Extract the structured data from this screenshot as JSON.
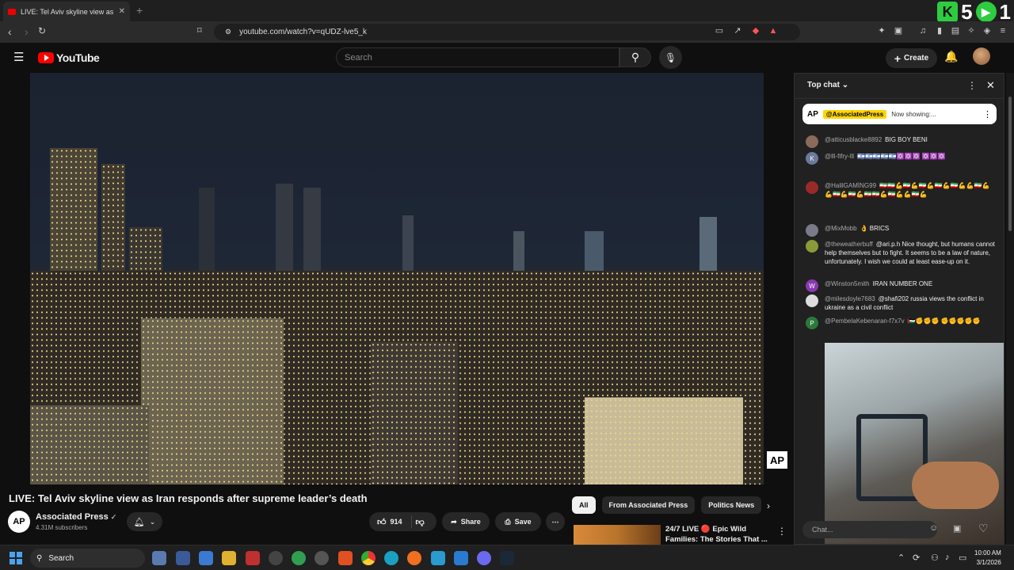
{
  "browser": {
    "tab_title": "LIVE: Tel Aviv skyline view as I",
    "new_tab": "+",
    "url": "youtube.com/watch?v=qUDZ-lve5_k",
    "overlay_count_a": "5",
    "overlay_count_b": "1"
  },
  "header": {
    "logo_text": "YouTube",
    "search_placeholder": "Search",
    "create_label": "Create"
  },
  "video": {
    "title": "LIVE: Tel Aviv skyline view as Iran responds after supreme leader’s death",
    "watermark": "AP"
  },
  "channel": {
    "avatar_text": "AP",
    "name": "Associated Press",
    "verified": "✓",
    "subscribers": "4.31M subscribers"
  },
  "actions": {
    "likes": "914",
    "share_label": "Share",
    "save_label": "Save"
  },
  "chips": [
    "All",
    "From Associated Press",
    "Politics News"
  ],
  "recommendation": {
    "title_line1": "24/7 LIVE 🔴 Epic Wild",
    "title_line2": "Families: The Stories That ..."
  },
  "chat": {
    "header": "Top chat",
    "pinned_avatar": "AP",
    "pinned_user": "@AssociatedPress",
    "pinned_text": "Now showing:...",
    "input_placeholder": "Chat...",
    "messages": [
      {
        "avatar": "",
        "user": "@atticusblacke8892",
        "text": "BIG BOY BENI",
        "color": "#8a6a5a"
      },
      {
        "avatar": "K",
        "user": "@lll-fifry-lll",
        "text": "🇮🇱🇮🇱🇮🇱🇮🇱🇮🇱✡️✡️✡️ ✡️✡️✡️",
        "color": "#6a7a9a"
      },
      {
        "avatar": "",
        "user": "@HalilGAMİNG99",
        "text": "🇮🇷🇮🇷💪🇮🇷💪🇮🇷💪🇮🇷💪🇮🇷💪💪🇮🇷💪💪🇮🇷💪🇮🇷💪🇮🇷🇮🇷💪🇮🇷💪💪🇮🇷💪",
        "color": "#9a2a2a"
      },
      {
        "avatar": "",
        "user": "@MixMobb",
        "text": "👌 BRICS",
        "color": "#7a7a8a"
      },
      {
        "avatar": "",
        "user": "@theweatherbuff",
        "text": "@ari.p.h Nice thought, but humans cannot help themselves but to fight. It seems to be a law of nature, unfortunately. I wish we could at least ease-up on it.",
        "color": "#8a9a3a"
      },
      {
        "avatar": "W",
        "user": "@Winston5mith",
        "text": "IRAN NUMBER ONE",
        "color": "#8a3ab0"
      },
      {
        "avatar": "",
        "user": "@milesdoyle7683",
        "text": "@shafi202 russia views the conflict in ukraine as a civil conflict",
        "color": "#ddd"
      },
      {
        "avatar": "P",
        "user": "@PembelaKebenaran-f7x7v",
        "text": "🇵🇸✊✊✊ ✊✊✊✊✊",
        "color": "#2a7a3a"
      }
    ]
  },
  "taskbar": {
    "search_label": "Search",
    "time": "10:00 AM",
    "date": "3/1/2026"
  }
}
